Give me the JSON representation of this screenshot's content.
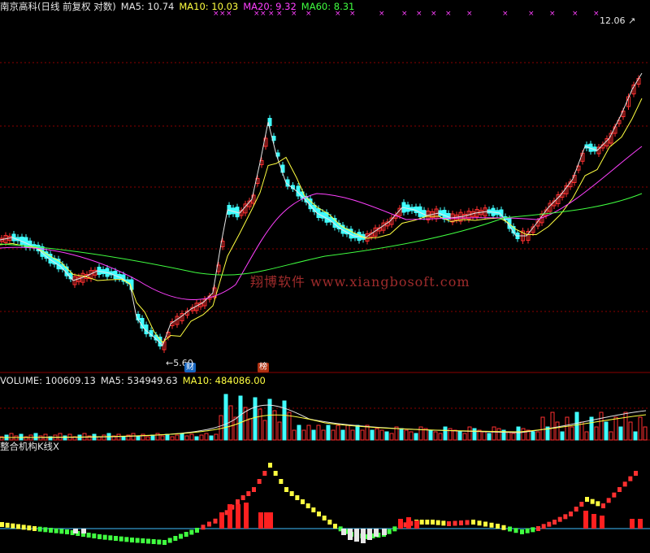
{
  "header_main": {
    "stock": "南京高科(日线 前复权 对数)",
    "ma5": "MA5: 10.74",
    "ma10": "MA10: 10.03",
    "ma20": "MA20: 9.32",
    "ma60": "MA60: 8.31"
  },
  "header_volume": {
    "volume": "VOLUME: 100609.13",
    "ma5": "MA5: 534949.63",
    "ma10": "MA10: 484086.00"
  },
  "header_indicator": {
    "name": "整合机构K线X"
  },
  "annotations": {
    "high_price": "12.06",
    "low_price": "5.60",
    "badge_cai": "财",
    "badge_bang": "榜",
    "watermark": "翔博软件 www.xiangbosoft.com"
  },
  "colors": {
    "up": "#ff3030",
    "down": "#40ffff",
    "ma5": "#e6e6e6",
    "ma10": "#ffff40",
    "ma20": "#ff40ff",
    "ma60": "#40ff40",
    "grid": "#8b0000",
    "baseline": "#40c0ff"
  }
}
